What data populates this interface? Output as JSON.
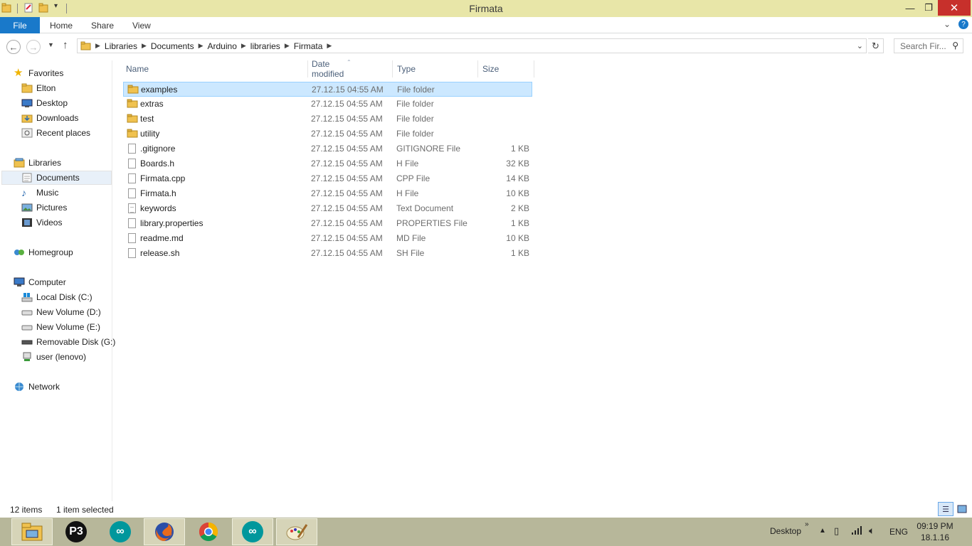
{
  "window": {
    "title": "Firmata"
  },
  "ribbon": {
    "file": "File",
    "home": "Home",
    "share": "Share",
    "view": "View"
  },
  "breadcrumb": [
    "Libraries",
    "Documents",
    "Arduino",
    "libraries",
    "Firmata"
  ],
  "search": {
    "placeholder": "Search Fir..."
  },
  "nav": {
    "favorites": "Favorites",
    "elton": "Elton",
    "desktop": "Desktop",
    "downloads": "Downloads",
    "recent": "Recent places",
    "libraries": "Libraries",
    "documents": "Documents",
    "music": "Music",
    "pictures": "Pictures",
    "videos": "Videos",
    "homegroup": "Homegroup",
    "computer": "Computer",
    "local_disk": "Local Disk (C:)",
    "vol_d": "New Volume (D:)",
    "vol_e": "New Volume (E:)",
    "removable": "Removable Disk (G:)",
    "user": "user (lenovo)",
    "network": "Network"
  },
  "columns": {
    "name": "Name",
    "date": "Date modified",
    "type": "Type",
    "size": "Size"
  },
  "files": [
    {
      "name": "examples",
      "date": "27.12.15 04:55 AM",
      "type": "File folder",
      "size": ""
    },
    {
      "name": "extras",
      "date": "27.12.15 04:55 AM",
      "type": "File folder",
      "size": ""
    },
    {
      "name": "test",
      "date": "27.12.15 04:55 AM",
      "type": "File folder",
      "size": ""
    },
    {
      "name": "utility",
      "date": "27.12.15 04:55 AM",
      "type": "File folder",
      "size": ""
    },
    {
      "name": ".gitignore",
      "date": "27.12.15 04:55 AM",
      "type": "GITIGNORE File",
      "size": "1 KB"
    },
    {
      "name": "Boards.h",
      "date": "27.12.15 04:55 AM",
      "type": "H File",
      "size": "32 KB"
    },
    {
      "name": "Firmata.cpp",
      "date": "27.12.15 04:55 AM",
      "type": "CPP File",
      "size": "14 KB"
    },
    {
      "name": "Firmata.h",
      "date": "27.12.15 04:55 AM",
      "type": "H File",
      "size": "10 KB"
    },
    {
      "name": "keywords",
      "date": "27.12.15 04:55 AM",
      "type": "Text Document",
      "size": "2 KB"
    },
    {
      "name": "library.properties",
      "date": "27.12.15 04:55 AM",
      "type": "PROPERTIES File",
      "size": "1 KB"
    },
    {
      "name": "readme.md",
      "date": "27.12.15 04:55 AM",
      "type": "MD File",
      "size": "10 KB"
    },
    {
      "name": "release.sh",
      "date": "27.12.15 04:55 AM",
      "type": "SH File",
      "size": "1 KB"
    }
  ],
  "status": {
    "count": "12 items",
    "selected": "1 item selected"
  },
  "taskbar": {
    "desktop": "Desktop",
    "lang": "ENG",
    "time": "09:19 PM",
    "date": "18.1.16",
    "apps": [
      "file-explorer-icon",
      "p3-app-icon",
      "arduino-icon",
      "firefox-icon",
      "chrome-icon",
      "arduino-icon",
      "paint-icon"
    ]
  },
  "colors": {
    "titlebar": "#e8e6a8",
    "file_tab": "#1979ca",
    "selection": "#cce8ff",
    "close": "#c7302b",
    "taskbar": "#b7b79a"
  }
}
